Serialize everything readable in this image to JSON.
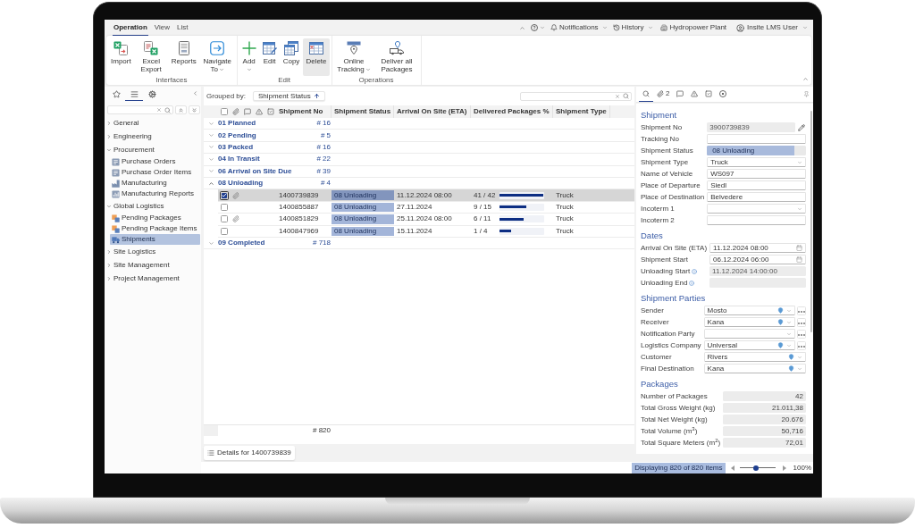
{
  "menu_tabs": [
    {
      "label": "Operation",
      "selected": true
    },
    {
      "label": "View",
      "selected": false
    },
    {
      "label": "List",
      "selected": false
    }
  ],
  "top_bar": {
    "notifications": "Notifications",
    "history": "History",
    "project": "Hydropower Plant",
    "user": "Insite LMS User"
  },
  "ribbon": {
    "groups": [
      {
        "label": "Interfaces",
        "buttons": [
          {
            "label": "Import",
            "dropdown": false,
            "hovered": false
          },
          {
            "label": "Excel Export",
            "dropdown": false,
            "hovered": false
          },
          {
            "label": "Reports",
            "dropdown": false,
            "hovered": false
          },
          {
            "label": "Navigate To",
            "dropdown": true,
            "hovered": false
          }
        ]
      },
      {
        "label": "Edit",
        "buttons": [
          {
            "label": "Add",
            "dropdown": true,
            "hovered": false
          },
          {
            "label": "Edit",
            "dropdown": false,
            "hovered": false
          },
          {
            "label": "Copy",
            "dropdown": false,
            "hovered": false
          },
          {
            "label": "Delete",
            "dropdown": false,
            "hovered": true
          }
        ]
      },
      {
        "label": "Operations",
        "buttons": [
          {
            "label": "Online Tracking",
            "dropdown": true,
            "hovered": false
          },
          {
            "label": "Deliver all Packages",
            "dropdown": false,
            "hovered": false
          }
        ]
      }
    ]
  },
  "sidebar": {
    "tabs": [
      {
        "selected": false
      },
      {
        "selected": true
      },
      {
        "selected": false
      }
    ],
    "tree": [
      {
        "label": "General",
        "expanded": false
      },
      {
        "label": "Engineering",
        "expanded": false
      },
      {
        "label": "Procurement",
        "expanded": true,
        "children": [
          {
            "label": "Purchase Orders",
            "selected": false
          },
          {
            "label": "Purchase Order Items",
            "selected": false
          },
          {
            "label": "Manufacturing",
            "selected": false
          },
          {
            "label": "Manufacturing Reports",
            "selected": false
          }
        ]
      },
      {
        "label": "Global Logistics",
        "expanded": true,
        "children": [
          {
            "label": "Pending Packages",
            "selected": false
          },
          {
            "label": "Pending Package Items",
            "selected": false
          },
          {
            "label": "Shipments",
            "selected": true
          }
        ]
      },
      {
        "label": "Site Logistics",
        "expanded": false
      },
      {
        "label": "Site Management",
        "expanded": false
      },
      {
        "label": "Project Management",
        "expanded": false
      }
    ]
  },
  "grid": {
    "grouped_by": "Grouped by:",
    "group_chip": "Shipment Status",
    "select_all_checked": false,
    "columns": [
      "Shipment No",
      "Shipment Status",
      "Arrival On Site (ETA)",
      "Delivered Packages %",
      "Shipment Type"
    ],
    "groups": [
      {
        "label": "01 Planned",
        "count": "# 16",
        "expanded": false
      },
      {
        "label": "02 Pending",
        "count": "# 5",
        "expanded": false
      },
      {
        "label": "03 Packed",
        "count": "# 16",
        "expanded": false
      },
      {
        "label": "04 In Transit",
        "count": "# 22",
        "expanded": false
      },
      {
        "label": "06 Arrival on Site Due",
        "count": "# 39",
        "expanded": false
      },
      {
        "label": "08 Unloading",
        "count": "# 4",
        "expanded": true,
        "rows": [
          {
            "selected": true,
            "checked": true,
            "attachment": true,
            "shipment_no": "1400739839",
            "status": "08 Unloading",
            "eta": "11.12.2024 08:00",
            "delivered": "41 / 42",
            "level": 0.976,
            "type": "Truck"
          },
          {
            "selected": false,
            "checked": false,
            "attachment": false,
            "shipment_no": "1400855887",
            "status": "08 Unloading",
            "eta": "27.11.2024",
            "delivered": "9 / 15",
            "level": 0.6,
            "type": "Truck"
          },
          {
            "selected": false,
            "checked": false,
            "attachment": true,
            "shipment_no": "1400851829",
            "status": "08 Unloading",
            "eta": "25.11.2024 08:00",
            "delivered": "6 / 11",
            "level": 0.545,
            "type": "Truck"
          },
          {
            "selected": false,
            "checked": false,
            "attachment": false,
            "shipment_no": "1400847969",
            "status": "08 Unloading",
            "eta": "15.11.2024",
            "delivered": "1 / 4",
            "level": 0.25,
            "type": "Truck"
          }
        ]
      },
      {
        "label": "09 Completed",
        "count": "# 718",
        "expanded": false
      }
    ],
    "total": "# 820",
    "details_button": "Details for 1400739839"
  },
  "details": {
    "tabs": [
      {
        "selected": true
      },
      {
        "count": "2",
        "selected": false
      },
      {
        "selected": false
      },
      {
        "selected": false
      },
      {
        "selected": false
      },
      {
        "selected": false
      }
    ],
    "sections": [
      {
        "title": "Shipment",
        "fields": [
          {
            "label": "Shipment No",
            "kind": "readonly",
            "value": "3900739839",
            "edit": true
          },
          {
            "label": "Tracking No",
            "kind": "text"
          },
          {
            "label": "Shipment Status",
            "kind": "status",
            "value": "08 Unloading",
            "level": 0.88
          },
          {
            "label": "Shipment Type",
            "kind": "select",
            "value": "Truck"
          },
          {
            "label": "Name of Vehicle",
            "kind": "text",
            "value": "WS097"
          },
          {
            "label": "Place of Departure",
            "kind": "text",
            "value": "Siedl"
          },
          {
            "label": "Place of Destination",
            "kind": "text",
            "value": "Belvedere"
          },
          {
            "label": "Incoterm 1",
            "kind": "select"
          },
          {
            "label": "Incoterm 2",
            "kind": "text"
          }
        ]
      },
      {
        "title": "Dates",
        "fields": [
          {
            "label": "Arrival On Site (ETA)",
            "kind": "date",
            "value": "11.12.2024 08:00"
          },
          {
            "label": "Shipment Start",
            "kind": "date",
            "value": "06.12.2024 06:00"
          },
          {
            "label": "Unloading Start",
            "kind": "readonly",
            "value": "11.12.2024 14:00:00",
            "info": true
          },
          {
            "label": "Unloading End",
            "kind": "readonly",
            "info": true
          }
        ]
      },
      {
        "title": "Shipment Parties",
        "fields": [
          {
            "label": "Sender",
            "kind": "lookup",
            "value": "Mosto",
            "pin": true,
            "more": true
          },
          {
            "label": "Receiver",
            "kind": "lookup",
            "value": "Kana",
            "pin": true,
            "more": true
          },
          {
            "label": "Notification Party",
            "kind": "lookup",
            "pin": false,
            "more": true
          },
          {
            "label": "Logistics Company",
            "kind": "lookup",
            "value": "Universal",
            "pin": true,
            "more": true
          },
          {
            "label": "Customer",
            "kind": "lookup",
            "value": "Rivers",
            "pin": true,
            "more": false
          },
          {
            "label": "Final Destination",
            "kind": "lookup",
            "value": "Kana",
            "pin": true,
            "more": false
          }
        ]
      },
      {
        "title": "Packages",
        "fields": [
          {
            "label": "Number of Packages",
            "kind": "number",
            "value": "42"
          },
          {
            "label": "Total Gross Weight (kg)",
            "kind": "number",
            "value": "21.011,38"
          },
          {
            "label": "Total Net Weight (kg)",
            "kind": "number",
            "value": "20.676"
          },
          {
            "label": "Total Volume (m$^{3}$)",
            "kind": "number",
            "value": "50,716"
          },
          {
            "label": "Total Square Meters (m$^{2}$)",
            "kind": "number",
            "value": "72,01"
          }
        ]
      }
    ]
  },
  "status_bar": {
    "summary": "Displaying 820 of 820 items",
    "zoom": {
      "level": 0.45,
      "reading": "100%"
    }
  }
}
